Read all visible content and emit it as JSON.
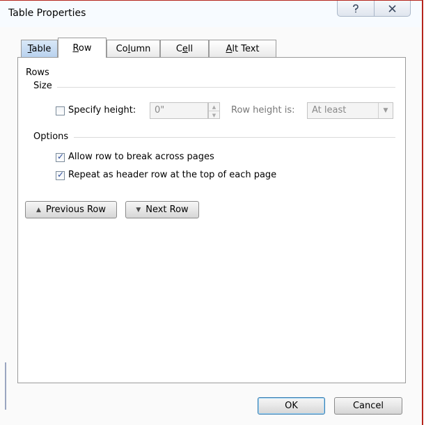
{
  "window": {
    "title": "Table Properties",
    "help_icon": "help-icon",
    "close_icon": "close-icon"
  },
  "tabs": [
    {
      "label": "Table",
      "mnemonic_index": 0
    },
    {
      "label": "Row",
      "mnemonic_index": 0,
      "active": true
    },
    {
      "label": "Column",
      "mnemonic_index": 2
    },
    {
      "label": "Cell",
      "mnemonic_index": 1
    },
    {
      "label": "Alt Text",
      "mnemonic_index": 0
    }
  ],
  "rows_section": {
    "heading": "Rows",
    "size": {
      "heading": "Size",
      "specify_height_label": "Specify height:",
      "specify_height_checked": false,
      "height_value": "0\"",
      "row_height_is_label": "Row height is:",
      "row_height_is_value": "At least"
    },
    "options": {
      "heading": "Options",
      "allow_break_label": "Allow row to break across pages",
      "allow_break_checked": true,
      "repeat_header_label": "Repeat as header row at the top of each page",
      "repeat_header_checked": true
    }
  },
  "nav": {
    "previous_label": "Previous Row",
    "previous_icon": "triangle-up-icon",
    "next_label": "Next Row",
    "next_icon": "triangle-down-icon"
  },
  "footer": {
    "ok_label": "OK",
    "cancel_label": "Cancel"
  }
}
